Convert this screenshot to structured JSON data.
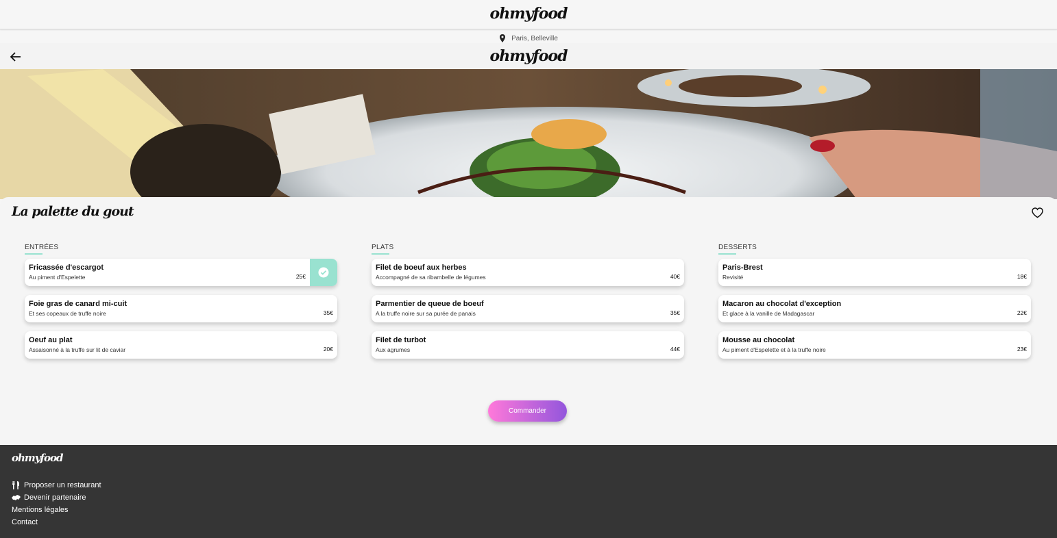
{
  "brand": {
    "logo": "ohmyfood"
  },
  "location": {
    "text": "Paris, Belleville",
    "icon": "map-pin-icon"
  },
  "restaurant": {
    "name": "La palette du gout"
  },
  "menu": {
    "columns": [
      {
        "title": "ENTRÉES",
        "dishes": [
          {
            "name": "Fricassée d'escargot",
            "desc": "Au piment d'Espelette",
            "price": "25€",
            "selected": true
          },
          {
            "name": "Foie gras de canard mi-cuit",
            "desc": "Et ses copeaux de truffe noire",
            "price": "35€",
            "selected": false
          },
          {
            "name": "Oeuf au plat",
            "desc": "Assaisonné à la truffe sur lit de caviar",
            "price": "20€",
            "selected": false
          }
        ]
      },
      {
        "title": "PLATS",
        "dishes": [
          {
            "name": "Filet de boeuf aux herbes",
            "desc": "Accompagné de sa ribambelle de légumes",
            "price": "40€",
            "selected": false
          },
          {
            "name": "Parmentier de queue de boeuf",
            "desc": "A la truffe noire sur sa purée de panais",
            "price": "35€",
            "selected": false
          },
          {
            "name": "Filet de turbot",
            "desc": "Aux agrumes",
            "price": "44€",
            "selected": false
          }
        ]
      },
      {
        "title": "DESSERTS",
        "dishes": [
          {
            "name": "Paris-Brest",
            "desc": "Revisité",
            "price": "18€",
            "selected": false
          },
          {
            "name": "Macaron au chocolat d'exception",
            "desc": "Et glace à la vanille de Madagascar",
            "price": "22€",
            "selected": false
          },
          {
            "name": "Mousse au chocolat",
            "desc": "Au piment d'Espelette et à la truffe noire",
            "price": "23€",
            "selected": false
          }
        ]
      }
    ]
  },
  "order_button": {
    "label": "Commander"
  },
  "footer": {
    "logo": "ohmyfood",
    "links": [
      {
        "label": "Proposer un restaurant",
        "icon": "utensils-icon"
      },
      {
        "label": "Devenir partenaire",
        "icon": "handshake-icon"
      },
      {
        "label": "Mentions légales",
        "icon": ""
      },
      {
        "label": "Contact",
        "icon": ""
      }
    ]
  },
  "colors": {
    "accent": "#99e2d0",
    "gradient_start": "#ff79da",
    "gradient_end": "#9356dc",
    "footer_bg": "#353535"
  }
}
